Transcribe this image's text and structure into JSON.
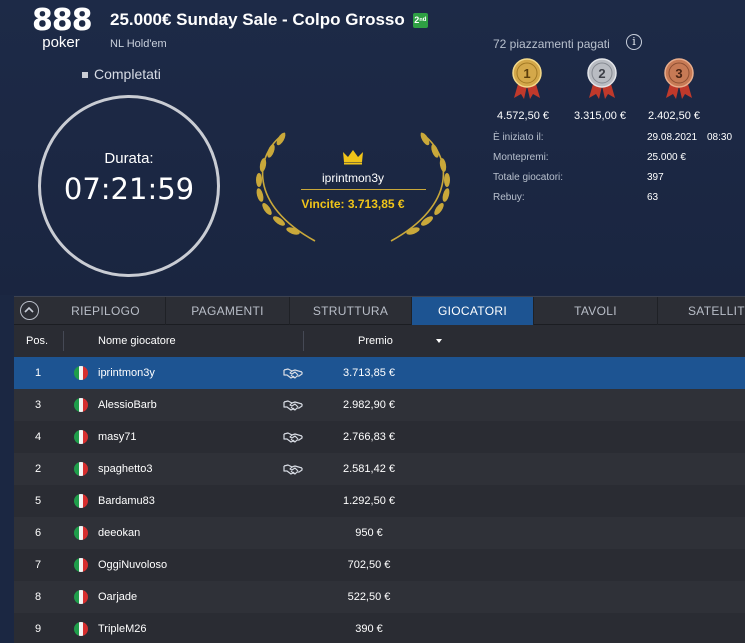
{
  "header": {
    "logo_number": "888",
    "logo_word": "poker",
    "title": "25.000€ Sunday Sale - Colpo Grosso",
    "badge": "2ⁿᵈ",
    "game_type": "NL Hold'em",
    "status": "Completati"
  },
  "timer": {
    "label": "Durata:",
    "value": "07:21:59"
  },
  "winner": {
    "name": "iprintmon3y",
    "prize": "Vincite: 3.713,85 €"
  },
  "payouts": {
    "paid_places": "72 piazzamenti pagati",
    "medals": [
      {
        "place": "1",
        "amount": "4.572,50 €",
        "color": "#d4a84a"
      },
      {
        "place": "2",
        "amount": "3.315,00 €",
        "color": "#b9bcc2"
      },
      {
        "place": "3",
        "amount": "2.402,50 €",
        "color": "#c77a55"
      }
    ]
  },
  "info": {
    "started_label": "È iniziato il:",
    "started_date": "29.08.2021",
    "started_time": "08:30",
    "prizepool_label": "Montepremi:",
    "prizepool_value": "25.000 €",
    "players_label": "Totale giocatori:",
    "players_value": "397",
    "rebuy_label": "Rebuy:",
    "rebuy_value": "63"
  },
  "tabs": [
    {
      "label": "RIEPILOGO",
      "active": false
    },
    {
      "label": "PAGAMENTI",
      "active": false
    },
    {
      "label": "STRUTTURA",
      "active": false
    },
    {
      "label": "GIOCATORI",
      "active": true
    },
    {
      "label": "TAVOLI",
      "active": false
    },
    {
      "label": "SATELLITI",
      "active": false
    }
  ],
  "table": {
    "columns": {
      "pos": "Pos.",
      "name": "Nome giocatore",
      "prize": "Premio"
    },
    "rows": [
      {
        "pos": "1",
        "name": "iprintmon3y",
        "prize": "3.713,85 €",
        "deal": true,
        "selected": true
      },
      {
        "pos": "3",
        "name": "AlessioBarb",
        "prize": "2.982,90 €",
        "deal": true,
        "selected": false
      },
      {
        "pos": "4",
        "name": "masy71",
        "prize": "2.766,83 €",
        "deal": true,
        "selected": false
      },
      {
        "pos": "2",
        "name": "spaghetto3",
        "prize": "2.581,42 €",
        "deal": true,
        "selected": false
      },
      {
        "pos": "5",
        "name": "Bardamu83",
        "prize": "1.292,50 €",
        "deal": false,
        "selected": false
      },
      {
        "pos": "6",
        "name": "deeokan",
        "prize": "950 €",
        "deal": false,
        "selected": false
      },
      {
        "pos": "7",
        "name": "OggiNuvoloso",
        "prize": "702,50 €",
        "deal": false,
        "selected": false
      },
      {
        "pos": "8",
        "name": "Oarjade",
        "prize": "522,50 €",
        "deal": false,
        "selected": false
      },
      {
        "pos": "9",
        "name": "TripleM26",
        "prize": "390 €",
        "deal": false,
        "selected": false
      }
    ]
  },
  "colors": {
    "accent_blue": "#1d5492",
    "gold": "#f0c419",
    "flag_green": "#1f9d4a",
    "flag_white": "#f4f4f4",
    "flag_red": "#d62e2e"
  }
}
